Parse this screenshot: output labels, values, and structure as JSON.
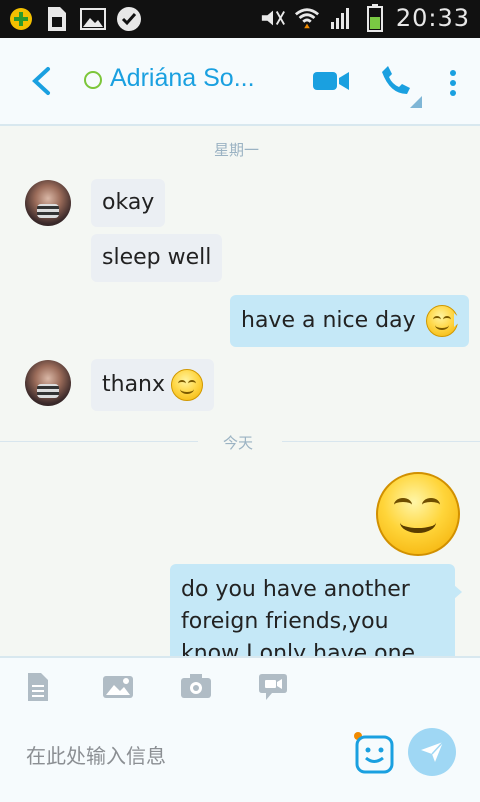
{
  "status_bar": {
    "time": "20:33",
    "icons": [
      "plus-circle-icon",
      "sim-file-icon",
      "image-icon",
      "check-badge-icon",
      "mute-icon",
      "wifi-icon",
      "signal-icon",
      "battery-icon"
    ]
  },
  "header": {
    "contact_name": "Adriána So...",
    "presence_color": "#7cc63a",
    "accent": "#1aa0e0"
  },
  "dates": {
    "first": "星期一",
    "second": "今天"
  },
  "messages": {
    "m1": "okay",
    "m2": "sleep well",
    "m3": "have a nice day",
    "m4": "thanx",
    "m5_line1": "do you have another",
    "m5_line2": "foreign friends,you",
    "m5_line3": "know I only have one"
  },
  "composer": {
    "placeholder": "在此处输入信息",
    "tools": [
      "document-icon",
      "photo-gallery-icon",
      "camera-icon",
      "video-message-icon"
    ]
  }
}
